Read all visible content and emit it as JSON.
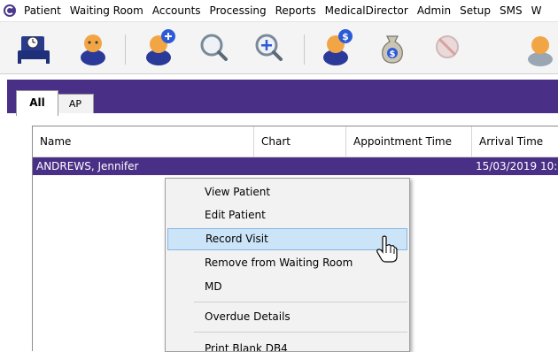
{
  "menubar": {
    "items": [
      "Patient",
      "Waiting Room",
      "Accounts",
      "Processing",
      "Reports",
      "MedicalDirector",
      "Admin",
      "Setup",
      "SMS",
      "W"
    ]
  },
  "toolbar": {
    "buttons": [
      "waiting-room-bed-icon",
      "patient-icon",
      "add-patient-icon",
      "search-icon",
      "zoom-in-icon",
      "patient-billing-icon",
      "money-bag-icon",
      "disabled-sms-icon",
      "doctor-icon"
    ]
  },
  "tabs": [
    {
      "label": "All",
      "active": true
    },
    {
      "label": "AP",
      "active": false
    }
  ],
  "grid": {
    "columns": [
      "Name",
      "Chart",
      "Appointment Time",
      "Arrival Time"
    ],
    "rows": [
      {
        "name": "ANDREWS, Jennifer",
        "chart": "",
        "appointment_time": "",
        "arrival_time": "15/03/2019 10:"
      }
    ]
  },
  "context_menu": {
    "items": [
      "View Patient",
      "Edit Patient",
      "Record Visit",
      "Remove from Waiting Room",
      "MD",
      "Overdue Details",
      "Print Blank DB4"
    ],
    "highlighted": "Record Visit"
  },
  "colors": {
    "accent_purple": "#4a2f86",
    "highlight": "#cce4f7"
  }
}
